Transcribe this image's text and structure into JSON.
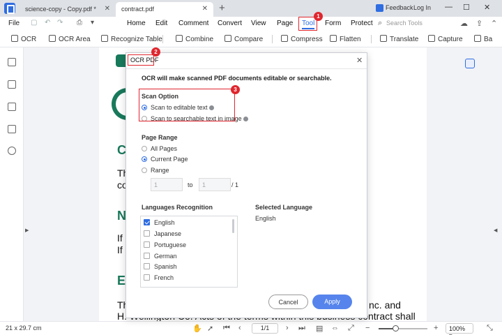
{
  "tabs": [
    {
      "label": "science-copy - Copy.pdf *"
    },
    {
      "label": "contract.pdf"
    }
  ],
  "titlebar": {
    "feedback": "Feedback",
    "login": "Log In"
  },
  "menu": {
    "file": "File",
    "items": [
      "Home",
      "Edit",
      "Comment",
      "Convert",
      "View",
      "Page",
      "Tool",
      "Form",
      "Protect"
    ],
    "active": "Tool",
    "search_placeholder": "Search Tools"
  },
  "toolbar": {
    "items": [
      "OCR",
      "OCR Area",
      "Recognize Table",
      "Combine",
      "Compare",
      "Compress",
      "Flatten",
      "Translate",
      "Capture",
      "Ba"
    ]
  },
  "document": {
    "line1": "Th",
    "line2": "co",
    "heading_n": "N",
    "line3": "If",
    "line4": "If",
    "heading_e": "E",
    "bottom1_left": "Th",
    "bottom1_right": "nc. and",
    "bottom2": "H. Wellington Co. Acts of the terms within this business contract shall"
  },
  "dialog": {
    "title": "OCR PDF",
    "description": "OCR will make scanned PDF documents editable or searchable.",
    "scan_option_label": "Scan Option",
    "scan_options": [
      "Scan to editable text",
      "Scan to searchable text in image"
    ],
    "page_range_label": "Page Range",
    "page_range_options": [
      "All Pages",
      "Current Page",
      "Range"
    ],
    "range_from": "1",
    "range_to": "1",
    "range_to_label": "to",
    "range_total": "/ 1",
    "languages_label": "Languages Recognition",
    "languages": [
      {
        "name": "English",
        "checked": true
      },
      {
        "name": "Japanese",
        "checked": false
      },
      {
        "name": "Portuguese",
        "checked": false
      },
      {
        "name": "German",
        "checked": false
      },
      {
        "name": "Spanish",
        "checked": false
      },
      {
        "name": "French",
        "checked": false
      }
    ],
    "selected_language_label": "Selected Language",
    "selected_language": "English",
    "cancel": "Cancel",
    "apply": "Apply"
  },
  "badges": [
    "1",
    "2",
    "3"
  ],
  "statusbar": {
    "page_size": "21 x 29.7 cm",
    "page_indicator": "1/1",
    "zoom_level": 0.35,
    "zoom": "100%"
  },
  "colors": {
    "accent": "#2f6de1",
    "callout": "#e0262e",
    "doc_green": "#18795b",
    "apply_button": "#5684ec"
  }
}
